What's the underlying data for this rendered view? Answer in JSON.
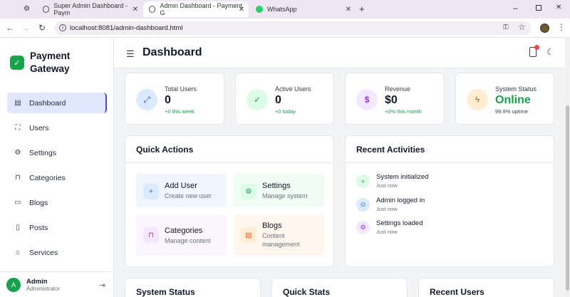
{
  "browser": {
    "tabs": [
      {
        "label": "Super Admin Dashboard - Paym",
        "active": false
      },
      {
        "label": "Admin Dashboard - Payment G",
        "active": true
      },
      {
        "label": "WhatsApp",
        "active": false
      }
    ],
    "url": "localhost:8081/admin-dashboard.html"
  },
  "sidebar": {
    "brand": "Payment Gateway",
    "items": [
      {
        "label": "Dashboard",
        "icon": "dashboard-icon",
        "active": true
      },
      {
        "label": "Users",
        "icon": "users-icon"
      },
      {
        "label": "Settings",
        "icon": "settings-icon"
      },
      {
        "label": "Categories",
        "icon": "categories-icon"
      },
      {
        "label": "Blogs",
        "icon": "blogs-icon"
      },
      {
        "label": "Posts",
        "icon": "posts-icon"
      },
      {
        "label": "Services",
        "icon": "services-icon"
      }
    ],
    "user": {
      "initial": "A",
      "name": "Admin",
      "role": "Administrator"
    }
  },
  "header": {
    "title": "Dashboard"
  },
  "stats": [
    {
      "label": "Total Users",
      "value": "0",
      "sub": "+0 this week",
      "icon": "users-chart-icon",
      "color": "#dbeafe",
      "icolor": "#2563eb",
      "valcolor": "#111827"
    },
    {
      "label": "Active Users",
      "value": "0",
      "sub": "+0 today",
      "icon": "check-circle-icon",
      "color": "#dcfce7",
      "icolor": "#16a34a",
      "valcolor": "#111827"
    },
    {
      "label": "Revenue",
      "value": "$0",
      "sub": "+0% this month",
      "icon": "dollar-icon",
      "color": "#f3e8ff",
      "icolor": "#9333ea",
      "valcolor": "#111827"
    },
    {
      "label": "System Status",
      "value": "Online",
      "sub": "99.9% uptime",
      "icon": "bolt-icon",
      "color": "#ffedd5",
      "icolor": "#ea580c",
      "valcolor": "#16a34a"
    }
  ],
  "quick_actions": {
    "title": "Quick Actions",
    "items": [
      {
        "title": "Add User",
        "sub": "Create new user",
        "bg": "#eff6ff",
        "ibg": "#dbeafe",
        "ic": "#2563eb"
      },
      {
        "title": "Settings",
        "sub": "Manage system",
        "bg": "#f0fdf4",
        "ibg": "#dcfce7",
        "ic": "#16a34a"
      },
      {
        "title": "Categories",
        "sub": "Manage content",
        "bg": "#faf5ff",
        "ibg": "#f3e8ff",
        "ic": "#9333ea"
      },
      {
        "title": "Blogs",
        "sub": "Content management",
        "bg": "#fff7ed",
        "ibg": "#ffedd5",
        "ic": "#ea580c"
      }
    ]
  },
  "recent_activities": {
    "title": "Recent Activities",
    "items": [
      {
        "title": "System initialized",
        "time": "Just now",
        "bg": "#dcfce7",
        "ic": "#16a34a"
      },
      {
        "title": "Admin logged in",
        "time": "Just now",
        "bg": "#dbeafe",
        "ic": "#2563eb"
      },
      {
        "title": "Settings loaded",
        "time": "Just now",
        "bg": "#f3e8ff",
        "ic": "#9333ea"
      }
    ]
  },
  "bottom_cards": [
    "System Status",
    "Quick Stats",
    "Recent Users"
  ]
}
